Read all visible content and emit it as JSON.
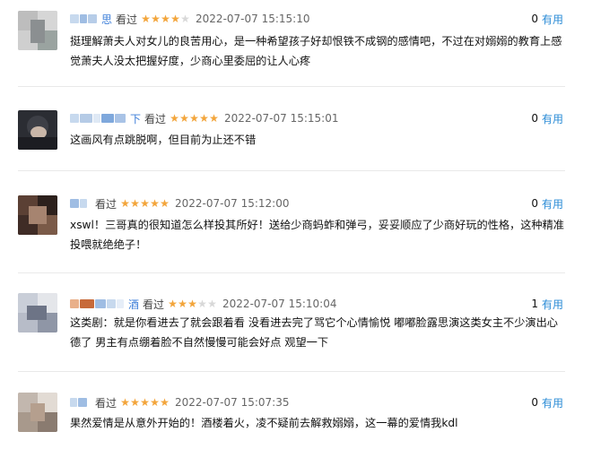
{
  "comments": [
    {
      "name_suffix": "思",
      "action": "看过",
      "rating": 4,
      "time": "2022-07-07 15:15:10",
      "votes": "0",
      "useful_label": "有用",
      "text": "挺理解萧夫人对女儿的良苦用心，是一种希望孩子好却恨铁不成钢的感情吧，不过在对嫋嫋的教育上感觉萧夫人没太把握好度，少商心里委屈的让人心疼"
    },
    {
      "name_suffix": "下",
      "action": "看过",
      "rating": 5,
      "time": "2022-07-07 15:15:01",
      "votes": "0",
      "useful_label": "有用",
      "text": "这画风有点跳脱啊，但目前为止还不错"
    },
    {
      "name_suffix": "",
      "action": "看过",
      "rating": 5,
      "time": "2022-07-07 15:12:00",
      "votes": "0",
      "useful_label": "有用",
      "text": "xswl！三哥真的很知道怎么样投其所好！送给少商蚂蚱和弹弓，妥妥顺应了少商好玩的性格，这种精准投喂就绝绝子！"
    },
    {
      "name_suffix": "酒",
      "action": "看过",
      "rating": 3,
      "time": "2022-07-07 15:10:04",
      "votes": "1",
      "useful_label": "有用",
      "text": "这类剧：就是你看进去了就会跟着看 没看进去完了骂它个心情愉悦 嘟嘟脸露思演这类女主不少演出心德了 男主有点绷着脸不自然慢慢可能会好点 观望一下"
    },
    {
      "name_suffix": "",
      "action": "看过",
      "rating": 5,
      "time": "2022-07-07 15:07:35",
      "votes": "0",
      "useful_label": "有用",
      "text": "果然爱情是从意外开始的！酒楼着火，凌不疑前去解救嫋嫋，这一幕的爱情我kdl"
    }
  ],
  "colors": {
    "star_on": "#f3a53b",
    "star_off": "#d8d8d8",
    "useful_link": "#2a8bd6"
  }
}
